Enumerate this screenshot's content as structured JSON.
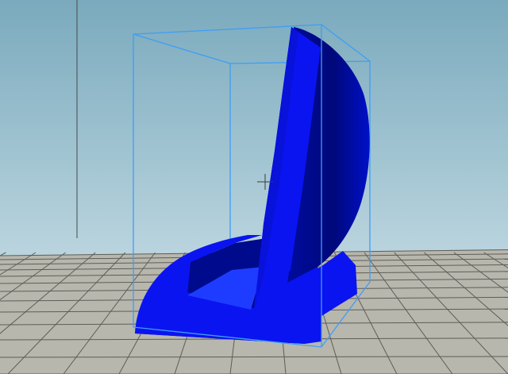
{
  "viewport": {
    "view": "3d-perspective",
    "background": {
      "top_color": "#7aaabd",
      "bottom_color": "#d8e8ee"
    },
    "build_plate": {
      "grid_fill": "#b8b7ae",
      "grid_line_color": "#5e5d57",
      "visible": true
    },
    "selected_model": {
      "color": "#0a14f0",
      "color_shade": "#000a8c",
      "color_highlight": "#1e3cff",
      "selected": true
    },
    "bounding_box": {
      "color": "#3f9df5",
      "visible": true
    },
    "axis_line": {
      "color": "#4a4a4a",
      "visible": true
    },
    "pivot_cursor": {
      "icon": "crosshair-icon",
      "color": "#3c3c3c"
    }
  }
}
